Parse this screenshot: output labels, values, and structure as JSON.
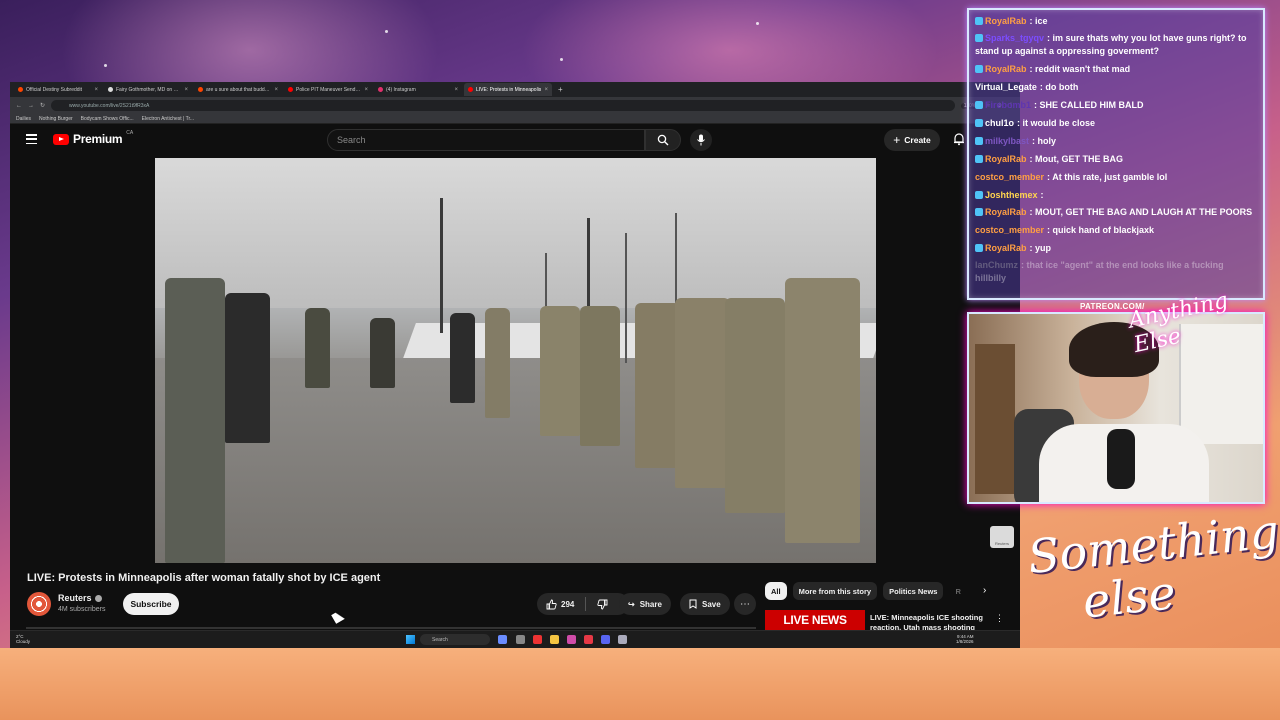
{
  "browser": {
    "tabs": [
      {
        "label": "Official Destiny Subreddit",
        "color": "#ff4500",
        "active": false
      },
      {
        "label": "Fairy Gothmother, MD on X: \"A",
        "color": "#dddddd",
        "active": false
      },
      {
        "label": "are u sure about that buddy : o",
        "color": "#ff4500",
        "active": false
      },
      {
        "label": "Police PIT Maneuver Sends An",
        "color": "#ff0000",
        "active": false
      },
      {
        "label": "(4) Instagram",
        "color": "#e1306c",
        "active": false
      },
      {
        "label": "LIVE: Protests in Minneapolis",
        "color": "#ff0000",
        "active": true
      }
    ],
    "url": "www.youtube.com/live/2S21t9fR3xA",
    "zoom": "110%",
    "bookmarks": [
      "Dailies",
      "Nothing Burger",
      "Bodycam Shows Offic...",
      "Electron Antichest | Tr..."
    ]
  },
  "youtube": {
    "logo_text": "Premium",
    "region": "CA",
    "search_placeholder": "Search",
    "create_label": "Create",
    "video_watermark": "Reuters",
    "video_title": "LIVE: Protests in Minneapolis after woman fatally shot by ICE agent",
    "channel_name": "Reuters",
    "subscribers": "4M subscribers",
    "subscribe_label": "Subscribe",
    "likes": "294",
    "share_label": "Share",
    "save_label": "Save",
    "chips": [
      "All",
      "More from this story",
      "Politics News",
      "R"
    ],
    "related_thumb_text": "LIVE NEWS",
    "related_title": "LIVE: Minneapolis ICE shooting reaction, Utah mass shooting"
  },
  "taskbar": {
    "weather_temp": "2°C",
    "weather_desc": "Cloudy",
    "search_label": "Search",
    "time": "9:44 AM",
    "date": "1/8/2026"
  },
  "chat": {
    "messages": [
      {
        "user": "RoyalRab",
        "color": "#ff9f43",
        "badge": true,
        "text": "ice"
      },
      {
        "user": "Sparks_tgyqv",
        "color": "#7c4dff",
        "badge": true,
        "text": "im sure thats why you lot have guns right? to stand up against a oppressing goverment?",
        "wrap": true
      },
      {
        "user": "RoyalRab",
        "color": "#ff9f43",
        "badge": true,
        "text": "reddit wasn't that mad"
      },
      {
        "user": "Virtual_Legate",
        "color": "#ffffff",
        "badge": false,
        "text": "do both"
      },
      {
        "user": "Firebomb1",
        "color": "#5e35b1",
        "badge": true,
        "text": "SHE CALLED HIM BALD"
      },
      {
        "user": "chul1o",
        "color": "#ffffff",
        "badge": true,
        "text": "it would be close"
      },
      {
        "user": "milkylbast",
        "color": "#7e57c2",
        "badge": true,
        "text": "holy"
      },
      {
        "user": "RoyalRab",
        "color": "#ff9f43",
        "badge": true,
        "text": "Mout, GET THE BAG"
      },
      {
        "user": "costco_member",
        "color": "#ff9f43",
        "badge": false,
        "text": "At this rate, just gamble lol"
      },
      {
        "user": "Joshthemex",
        "color": "#ffd54f",
        "badge": true,
        "text": ""
      },
      {
        "user": "RoyalRab",
        "color": "#ff9f43",
        "badge": true,
        "text": "MOUT, GET THE BAG AND LAUGH AT THE POORS",
        "wrap": true
      },
      {
        "user": "costco_member",
        "color": "#ff9f43",
        "badge": false,
        "text": "quick hand of blackjaxk"
      },
      {
        "user": "RoyalRab",
        "color": "#ff9f43",
        "badge": true,
        "text": "yup"
      },
      {
        "user": "lanChumz",
        "color": "#bbbbbb",
        "badge": false,
        "text": "that ice \"agent\" at the end looks like a fucking hillbilly",
        "wrap": true,
        "fade": true
      }
    ]
  },
  "overlay": {
    "patreon": "PATREON.COM/",
    "signature": "Anything Else",
    "brand_line1": "Something",
    "brand_line2": "else"
  }
}
